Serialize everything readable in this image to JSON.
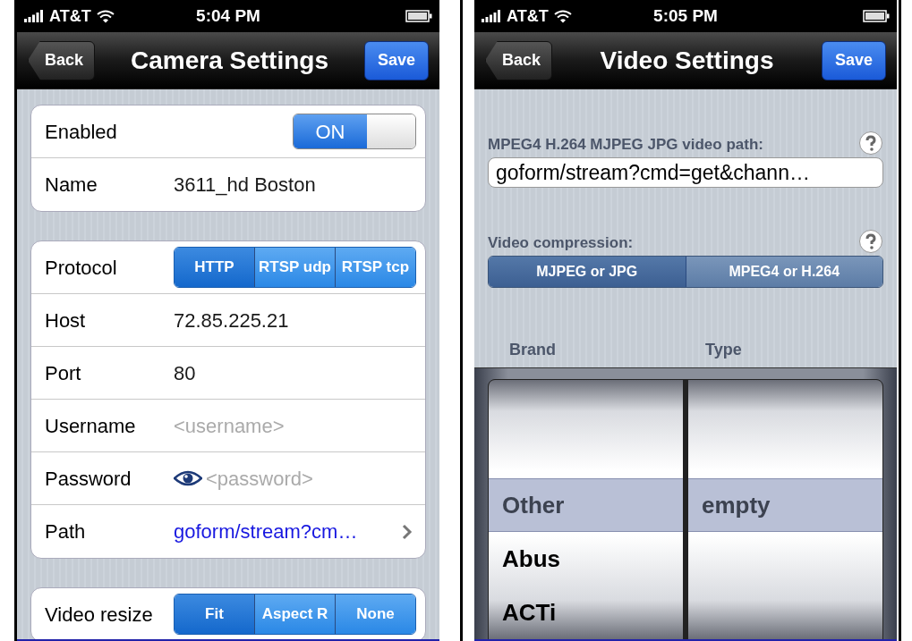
{
  "screens": [
    {
      "kind": "form",
      "status_bar": {
        "carrier": "AT&T",
        "time": "5:04 PM"
      },
      "nav": {
        "back": "Back",
        "title": "Camera Settings",
        "action": "Save"
      },
      "groups": [
        {
          "rows": [
            {
              "kind": "toggle",
              "label": "Enabled",
              "on": true,
              "switch_text": "ON"
            },
            {
              "kind": "text",
              "label": "Name",
              "value": "3611_hd Boston"
            }
          ]
        },
        {
          "rows": [
            {
              "kind": "segmented",
              "label": "Protocol",
              "options": [
                {
                  "label": "HTTP",
                  "selected": true
                },
                {
                  "label": "RTSP udp",
                  "selected": false
                },
                {
                  "label": "RTSP tcp",
                  "selected": false
                }
              ]
            },
            {
              "kind": "text",
              "label": "Host",
              "value": "72.85.225.21"
            },
            {
              "kind": "text",
              "label": "Port",
              "value": "80"
            },
            {
              "kind": "text",
              "label": "Username",
              "placeholder": "<username>"
            },
            {
              "kind": "password",
              "label": "Password",
              "placeholder": "<password>"
            },
            {
              "kind": "link",
              "label": "Path",
              "value": "goform/stream?cm…"
            }
          ]
        },
        {
          "rows": [
            {
              "kind": "segmented",
              "label": "Video resize",
              "options": [
                {
                  "label": "Fit",
                  "selected": true
                },
                {
                  "label": "Aspect R",
                  "selected": false
                },
                {
                  "label": "None",
                  "selected": false
                }
              ]
            }
          ]
        }
      ]
    },
    {
      "kind": "video",
      "status_bar": {
        "carrier": "AT&T",
        "time": "5:05 PM"
      },
      "nav": {
        "back": "Back",
        "title": "Video Settings",
        "action": "Save"
      },
      "path_label": "MPEG4 H.264 MJPEG JPG video path:",
      "path_value": "goform/stream?cmd=get&chann…",
      "compression_label": "Video compression:",
      "compression_options": [
        {
          "label": "MJPEG or JPG",
          "selected": true
        },
        {
          "label": "MPEG4 or H.264",
          "selected": false
        }
      ],
      "picker_columns": [
        {
          "header": "Brand",
          "items": [
            {
              "label": "Other",
              "selected": true
            },
            {
              "label": "Abus",
              "selected": false
            },
            {
              "label": "ACTi",
              "selected": false
            }
          ]
        },
        {
          "header": "Type",
          "items": [
            {
              "label": "empty",
              "selected": true
            }
          ]
        }
      ]
    }
  ]
}
